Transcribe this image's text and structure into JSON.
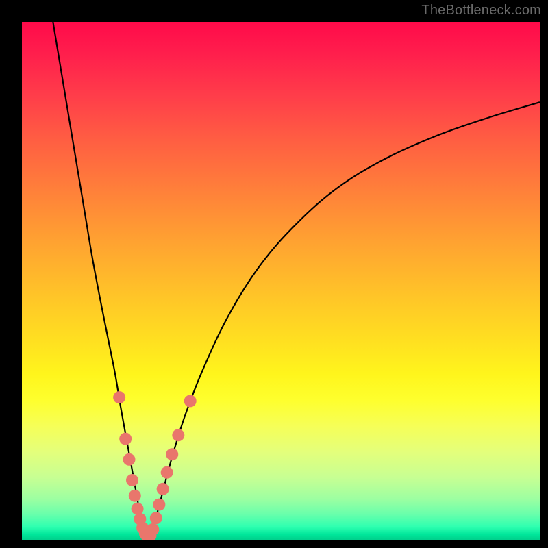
{
  "watermark": "TheBottleneck.com",
  "colors": {
    "marker_fill": "#e9766c",
    "curve_stroke": "#000000",
    "frame_bg": "#000000"
  },
  "chart_data": {
    "type": "line",
    "title": "",
    "xlabel": "",
    "ylabel": "",
    "xlim": [
      0,
      100
    ],
    "ylim": [
      0,
      100
    ],
    "grid": false,
    "legend": false,
    "series": [
      {
        "name": "left-curve",
        "x": [
          6.0,
          8.0,
          10.0,
          12.0,
          13.5,
          15.0,
          16.5,
          18.0,
          19.0,
          20.0,
          21.0,
          22.0,
          22.8,
          23.5,
          24.0
        ],
        "values": [
          100.0,
          88.0,
          76.0,
          64.0,
          55.0,
          47.0,
          39.5,
          32.0,
          26.0,
          20.5,
          15.0,
          9.5,
          5.0,
          2.0,
          0.5
        ]
      },
      {
        "name": "right-curve",
        "x": [
          24.5,
          25.5,
          27.0,
          29.0,
          31.5,
          35.0,
          40.0,
          46.0,
          53.0,
          61.0,
          70.0,
          80.0,
          90.0,
          100.0
        ],
        "values": [
          0.5,
          3.0,
          8.5,
          16.0,
          24.0,
          33.0,
          43.5,
          53.0,
          61.0,
          68.0,
          73.5,
          78.0,
          81.5,
          84.5
        ]
      }
    ],
    "markers": [
      {
        "series": "left-curve",
        "x": 18.8,
        "y": 27.5
      },
      {
        "series": "left-curve",
        "x": 20.0,
        "y": 19.5
      },
      {
        "series": "left-curve",
        "x": 20.7,
        "y": 15.5
      },
      {
        "series": "left-curve",
        "x": 21.3,
        "y": 11.5
      },
      {
        "series": "left-curve",
        "x": 21.8,
        "y": 8.5
      },
      {
        "series": "left-curve",
        "x": 22.3,
        "y": 6.0
      },
      {
        "series": "left-curve",
        "x": 22.8,
        "y": 4.0
      },
      {
        "series": "left-curve",
        "x": 23.3,
        "y": 2.3
      },
      {
        "series": "left-curve",
        "x": 23.8,
        "y": 1.2
      },
      {
        "series": "left-curve",
        "x": 24.2,
        "y": 0.6
      },
      {
        "series": "right-curve",
        "x": 24.8,
        "y": 0.8
      },
      {
        "series": "right-curve",
        "x": 25.3,
        "y": 2.0
      },
      {
        "series": "right-curve",
        "x": 25.9,
        "y": 4.2
      },
      {
        "series": "right-curve",
        "x": 26.5,
        "y": 6.8
      },
      {
        "series": "right-curve",
        "x": 27.2,
        "y": 9.8
      },
      {
        "series": "right-curve",
        "x": 28.0,
        "y": 13.0
      },
      {
        "series": "right-curve",
        "x": 29.0,
        "y": 16.5
      },
      {
        "series": "right-curve",
        "x": 30.2,
        "y": 20.2
      },
      {
        "series": "right-curve",
        "x": 32.5,
        "y": 26.8
      }
    ],
    "marker_radius_px": 9
  }
}
